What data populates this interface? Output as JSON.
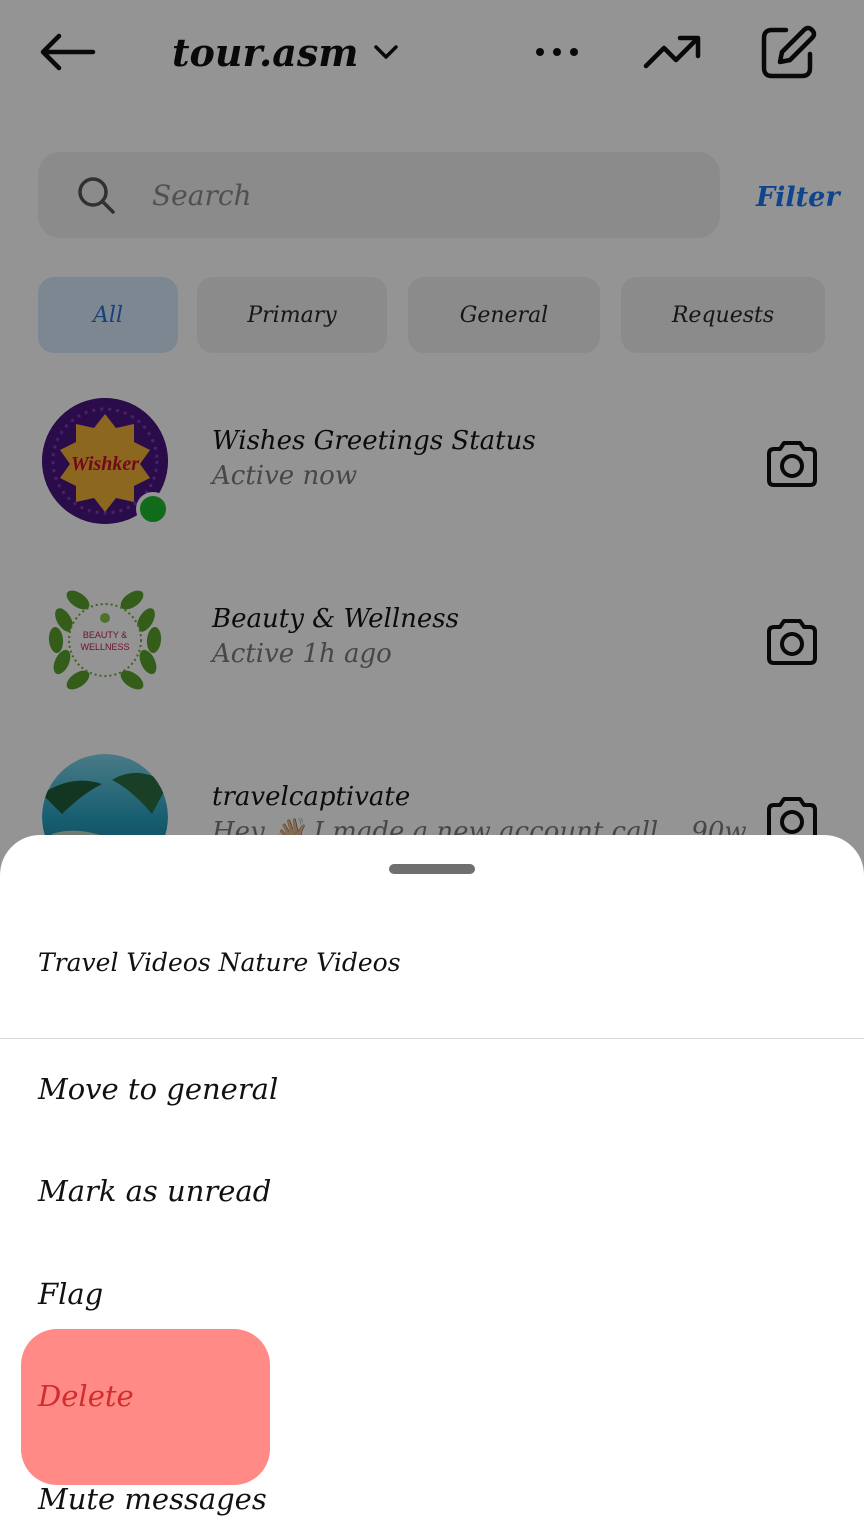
{
  "header": {
    "account_name": "tour.asm"
  },
  "search": {
    "placeholder": "Search",
    "filter_label": "Filter"
  },
  "tabs": [
    {
      "label": "All",
      "active": true
    },
    {
      "label": "Primary",
      "active": false
    },
    {
      "label": "General",
      "active": false
    },
    {
      "label": "Requests",
      "active": false
    }
  ],
  "conversations": [
    {
      "name": "Wishes Greetings Status",
      "status": "Active now",
      "avatar_text": "Wishker",
      "online": true
    },
    {
      "name": "Beauty & Wellness",
      "status": "Active 1h ago",
      "avatar_text": "BEAUTY & WELLNESS",
      "online": false
    },
    {
      "name": "travelcaptivate",
      "status": "Hey 👋🏼 I made a new account call... 90w",
      "online": false
    }
  ],
  "sheet": {
    "title": "Travel Videos Nature Videos",
    "actions": [
      {
        "label": "Move to general"
      },
      {
        "label": "Mark as unread"
      },
      {
        "label": "Flag"
      },
      {
        "label": "Delete",
        "danger": true,
        "highlighted": true
      },
      {
        "label": "Mute messages"
      }
    ]
  },
  "colors": {
    "accent_blue": "#1a77f2",
    "online_green": "#1dbb2f",
    "danger_red": "#cf2e2e",
    "highlight": "#ff8a86"
  }
}
